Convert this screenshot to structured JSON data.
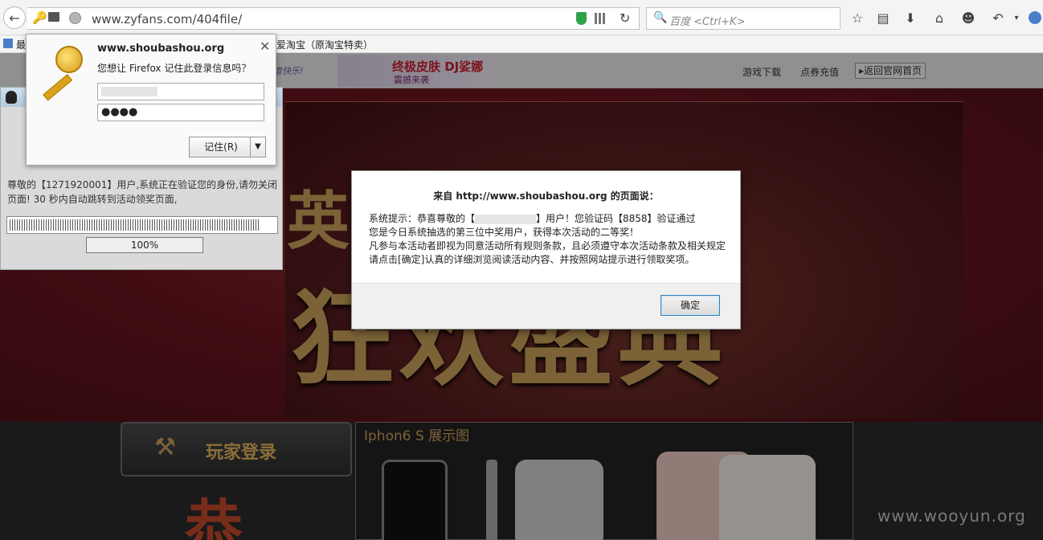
{
  "browser": {
    "url": "www.zyfans.com/404file/",
    "search_placeholder": "百度 <Ctrl+K>"
  },
  "bookmarks": {
    "item_1": "最",
    "item_2": "爱淘宝（原淘宝特卖）"
  },
  "site_header": {
    "slogan": "造快乐!",
    "banner_title": "终极皮肤 DJ娑娜",
    "banner_subtitle": "震撼来袭",
    "nav_download": "游戏下载",
    "nav_recharge": "点券充值",
    "nav_home": "返回官网首页"
  },
  "hero": {
    "char_1": "英",
    "big_text": "狂欢盛典"
  },
  "bottom": {
    "login_label": "玩家登录",
    "showcase_title": "Iphon6 S 展示图",
    "congrats_char": "恭"
  },
  "notice_panel": {
    "message": "尊敬的【1271920001】用户,系统正在验证您的身份,请勿关闭页面! 30 秒内自动跳转到活动领奖页面,",
    "progress_label": "100%"
  },
  "login_popup": {
    "domain": "www.shoubashou.org",
    "question": "您想让 Firefox 记住此登录信息吗？",
    "password_mask": "●●●●",
    "remember_label": "记住(R)",
    "close_glyph": "✕",
    "dropdown_glyph": "▼"
  },
  "alert": {
    "title": "来自 http://www.shoubashou.org 的页面说：",
    "line_1a": "系统提示：恭喜尊敬的【",
    "line_1b": "】用户！您验证码【8858】验证通过",
    "line_2": "您是今日系统抽选的第三位中奖用户，获得本次活动的二等奖！",
    "line_3": "凡参与本活动者即视为同意活动所有规则条款，且必须遵守本次活动条款及相关规定",
    "line_4": "请点击[确定]认真的详细浏览阅读活动内容、并按照网站提示进行领取奖项。",
    "ok_label": "确定"
  },
  "watermark": "www.wooyun.org",
  "colors": {
    "hero_red": "#6a1620",
    "gold": "#c9a15a",
    "dialog_button_border": "#3c7fb1"
  }
}
